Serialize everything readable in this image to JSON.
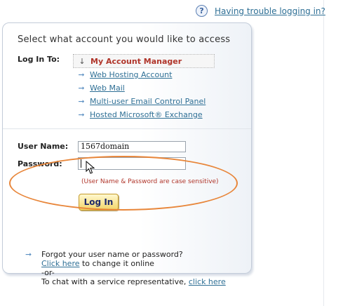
{
  "help_link": {
    "label": "Having trouble logging in?"
  },
  "panel": {
    "heading": "Select what account you would like to access",
    "log_in_to_label": "Log In To:",
    "options": [
      {
        "label": "My Account Manager"
      },
      {
        "label": "Web Hosting Account"
      },
      {
        "label": "Web Mail"
      },
      {
        "label": "Multi-user Email Control Panel"
      },
      {
        "label": "Hosted Microsoft® Exchange"
      }
    ]
  },
  "form": {
    "username_label": "User Name:",
    "username_value": "1567domain",
    "password_label": "Password:",
    "password_value": "",
    "case_note": "(User Name & Password are case sensitive)",
    "login_button": "Log In"
  },
  "help": {
    "forgot_text": "Forgot your user name or password?",
    "click_here_1": "Click here",
    "change_online": " to change it online",
    "or_text": "-or-",
    "chat_text": "To chat with a service representative, ",
    "click_here_2": "click here"
  },
  "colors": {
    "link": "#2e6f95",
    "selected_option": "#b0352a",
    "highlight_ellipse": "#e8863a",
    "login_button": "#f3d569"
  }
}
